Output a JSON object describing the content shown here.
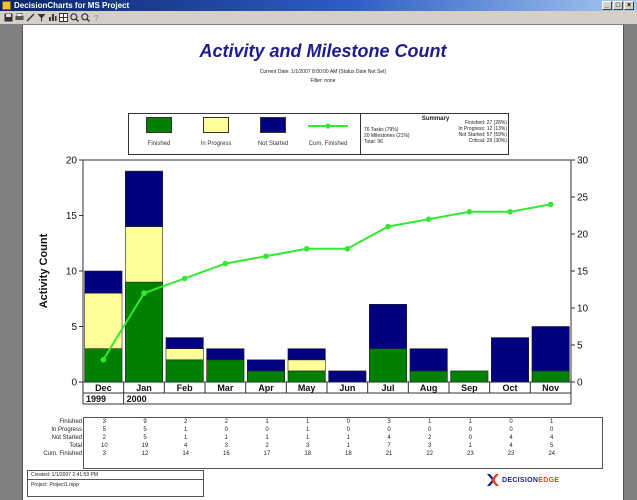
{
  "window": {
    "title": "DecisionCharts for MS Project"
  },
  "report": {
    "title": "Activity and Milestone Count",
    "current_date": "Current Date: 1/1/2007 8:00:00 AM (Status Date Not Set)",
    "filter": "Filter: none"
  },
  "legend": {
    "items": [
      {
        "label": "Finished",
        "color": "#008000"
      },
      {
        "label": "In Progress",
        "color": "#ffff99"
      },
      {
        "label": "Not Started",
        "color": "#000080"
      },
      {
        "label": "Cum. Finished",
        "color": "#33e833"
      }
    ]
  },
  "summary": {
    "title": "Summary",
    "tasks": "76 Tasks  (79%)",
    "milestones": "20 Milestones  (21%)",
    "total": "Total: 96",
    "finished": "Finished: 27 (28%)",
    "in_progress": "In Progress: 12 (13%)",
    "not_started": "Not Started: 57 (59%)",
    "critical": "Critical: 29 (30%)"
  },
  "chart_data": {
    "type": "bar",
    "stacked": true,
    "title": "",
    "ylabel": "Activity Count",
    "xlabel": "",
    "categories": [
      "Dec",
      "Jan",
      "Feb",
      "Mar",
      "Apr",
      "May",
      "Jun",
      "Jul",
      "Aug",
      "Sep",
      "Oct",
      "Nov"
    ],
    "year_labels": [
      {
        "label": "1999",
        "start": 0,
        "end": 0
      },
      {
        "label": "2000",
        "start": 1,
        "end": 11
      }
    ],
    "ylim": [
      0,
      20
    ],
    "yticks": [
      0,
      5,
      10,
      15,
      20
    ],
    "y2lim": [
      0,
      30
    ],
    "y2ticks": [
      0,
      5,
      10,
      15,
      20,
      25,
      30
    ],
    "grid": false,
    "series": [
      {
        "name": "Finished",
        "color": "#008000",
        "values": [
          3,
          9,
          2,
          2,
          1,
          1,
          0,
          3,
          1,
          1,
          0,
          1
        ]
      },
      {
        "name": "In Progress",
        "color": "#ffff99",
        "values": [
          5,
          5,
          1,
          0,
          0,
          1,
          0,
          0,
          0,
          0,
          0,
          0
        ]
      },
      {
        "name": "Not Started",
        "color": "#000080",
        "values": [
          2,
          5,
          1,
          1,
          1,
          1,
          1,
          4,
          2,
          0,
          4,
          4
        ]
      },
      {
        "name": "Cum. Finished",
        "type": "line",
        "axis": "right",
        "color": "#33e833",
        "values": [
          3,
          12,
          14,
          16,
          17,
          18,
          18,
          21,
          22,
          23,
          23,
          24
        ]
      }
    ]
  },
  "data_table": {
    "rows": [
      {
        "label": "Finished",
        "values": [
          "3",
          "9",
          "2",
          "2",
          "1",
          "1",
          "0",
          "3",
          "1",
          "1",
          "0",
          "1"
        ]
      },
      {
        "label": "In Progress",
        "values": [
          "5",
          "5",
          "1",
          "0",
          "0",
          "1",
          "0",
          "0",
          "0",
          "0",
          "0",
          "0"
        ]
      },
      {
        "label": "Not Started",
        "values": [
          "2",
          "5",
          "1",
          "1",
          "1",
          "1",
          "1",
          "4",
          "2",
          "0",
          "4",
          "4"
        ]
      },
      {
        "label": "Total",
        "values": [
          "10",
          "19",
          "4",
          "3",
          "2",
          "3",
          "1",
          "7",
          "3",
          "1",
          "4",
          "5"
        ]
      },
      {
        "label": "Cum. Finished",
        "values": [
          "3",
          "12",
          "14",
          "16",
          "17",
          "18",
          "18",
          "21",
          "22",
          "23",
          "23",
          "24"
        ]
      }
    ]
  },
  "footer": {
    "created": "Created: 1/1/2007 2:41:59 PM",
    "project": "Project: Project1.mpp"
  },
  "brand": {
    "prefix": "DECISION",
    "suffix": "EDGE"
  }
}
